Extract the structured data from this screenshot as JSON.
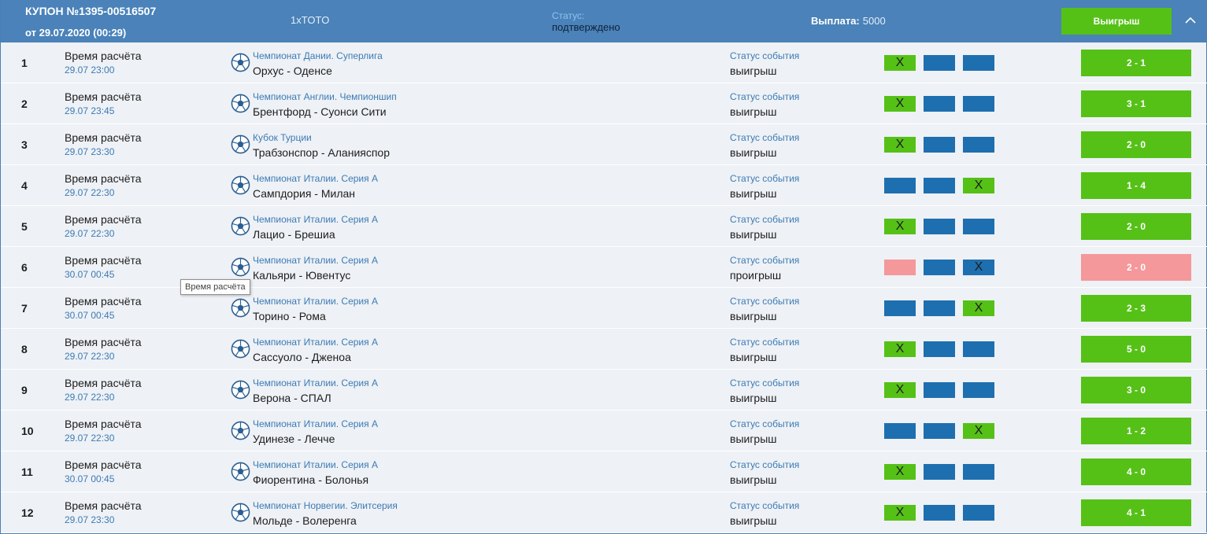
{
  "header": {
    "coupon_title": "КУПОН №1395-00516507",
    "coupon_date": "от 29.07.2020 (00:29)",
    "product": "1xTOTO",
    "status_label": "Статус:",
    "status_value": "подтверждено",
    "payout_label": "Выплата:",
    "payout_value": "5000",
    "result_button": "Выигрыш",
    "collapse_icon": "chevron-up-icon"
  },
  "tooltip": "Время расчёта",
  "row_labels": {
    "calc_label": "Время расчёта",
    "event_status_label": "Статус события",
    "sport_icon": "soccer-ball-icon"
  },
  "colors": {
    "header": "#4a82b9",
    "win": "#55c117",
    "lose": "#f4989b",
    "neutral": "#1e6fb0",
    "link": "#3c7bb5"
  },
  "rows": [
    {
      "num": "1",
      "time": "29.07 23:00",
      "league": "Чемпионат Дании. Суперлига",
      "match": "Орхус - Оденсе",
      "status": "выигрыш",
      "picks": [
        "win:X",
        "neutral:",
        "neutral:"
      ],
      "score": "2 - 1",
      "result": "win"
    },
    {
      "num": "2",
      "time": "29.07 23:45",
      "league": "Чемпионат Англии. Чемпионшип",
      "match": "Брентфорд - Суонси Сити",
      "status": "выигрыш",
      "picks": [
        "win:X",
        "neutral:",
        "neutral:"
      ],
      "score": "3 - 1",
      "result": "win"
    },
    {
      "num": "3",
      "time": "29.07 23:30",
      "league": "Кубок Турции",
      "match": "Трабзонспор - Аланияспор",
      "status": "выигрыш",
      "picks": [
        "win:X",
        "neutral:",
        "neutral:"
      ],
      "score": "2 - 0",
      "result": "win"
    },
    {
      "num": "4",
      "time": "29.07 22:30",
      "league": "Чемпионат Италии. Серия А",
      "match": "Сампдория - Милан",
      "status": "выигрыш",
      "picks": [
        "neutral:",
        "neutral:",
        "win:X"
      ],
      "score": "1 - 4",
      "result": "win"
    },
    {
      "num": "5",
      "time": "29.07 22:30",
      "league": "Чемпионат Италии. Серия А",
      "match": "Лацио - Брешиа",
      "status": "выигрыш",
      "picks": [
        "win:X",
        "neutral:",
        "neutral:"
      ],
      "score": "2 - 0",
      "result": "win"
    },
    {
      "num": "6",
      "time": "30.07 00:45",
      "league": "Чемпионат Италии. Серия А",
      "match": "Кальяри - Ювентус",
      "status": "проигрыш",
      "picks": [
        "lose:",
        "neutral:",
        "neutral:X"
      ],
      "score": "2 - 0",
      "result": "lose"
    },
    {
      "num": "7",
      "time": "30.07 00:45",
      "league": "Чемпионат Италии. Серия А",
      "match": "Торино - Рома",
      "status": "выигрыш",
      "picks": [
        "neutral:",
        "neutral:",
        "win:X"
      ],
      "score": "2 - 3",
      "result": "win"
    },
    {
      "num": "8",
      "time": "29.07 22:30",
      "league": "Чемпионат Италии. Серия А",
      "match": "Сассуоло - Дженоа",
      "status": "выигрыш",
      "picks": [
        "win:X",
        "neutral:",
        "neutral:"
      ],
      "score": "5 - 0",
      "result": "win"
    },
    {
      "num": "9",
      "time": "29.07 22:30",
      "league": "Чемпионат Италии. Серия А",
      "match": "Верона - СПАЛ",
      "status": "выигрыш",
      "picks": [
        "win:X",
        "neutral:",
        "neutral:"
      ],
      "score": "3 - 0",
      "result": "win"
    },
    {
      "num": "10",
      "time": "29.07 22:30",
      "league": "Чемпионат Италии. Серия А",
      "match": "Удинезе - Лечче",
      "status": "выигрыш",
      "picks": [
        "neutral:",
        "neutral:",
        "win:X"
      ],
      "score": "1 - 2",
      "result": "win"
    },
    {
      "num": "11",
      "time": "30.07 00:45",
      "league": "Чемпионат Италии. Серия А",
      "match": "Фиорентина - Болонья",
      "status": "выигрыш",
      "picks": [
        "win:X",
        "neutral:",
        "neutral:"
      ],
      "score": "4 - 0",
      "result": "win"
    },
    {
      "num": "12",
      "time": "29.07 23:30",
      "league": "Чемпионат Норвегии. Элитсерия",
      "match": "Мольде - Волеренга",
      "status": "выигрыш",
      "picks": [
        "win:X",
        "neutral:",
        "neutral:"
      ],
      "score": "4 - 1",
      "result": "win"
    }
  ]
}
